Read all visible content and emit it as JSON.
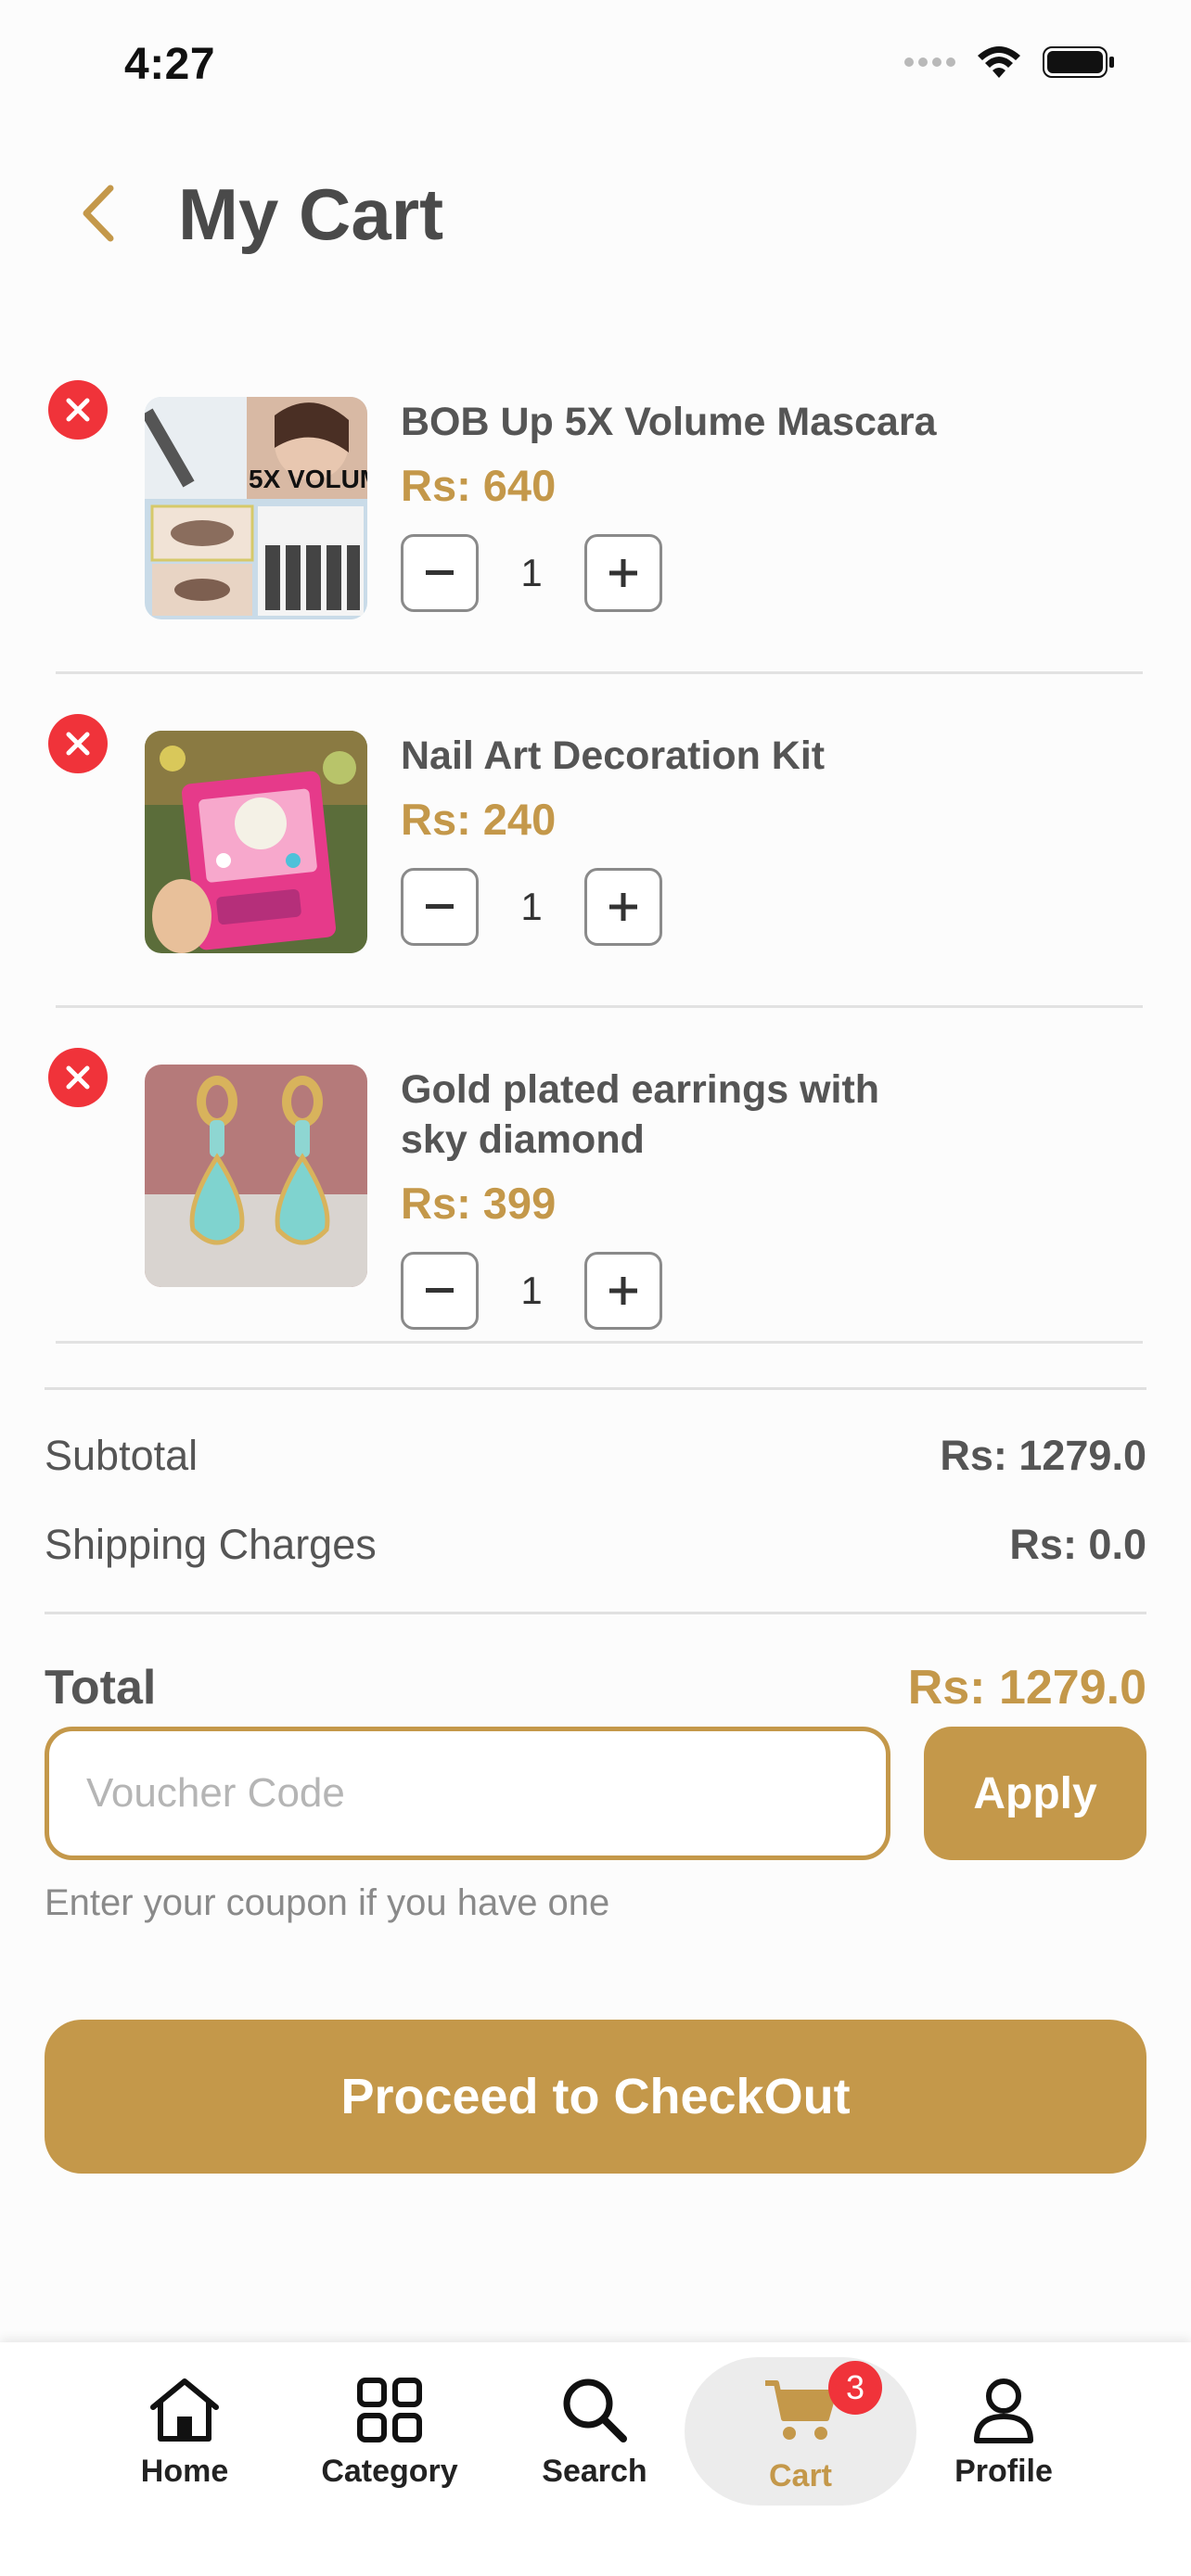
{
  "status_bar": {
    "time": "4:27"
  },
  "header": {
    "title": "My Cart"
  },
  "items": [
    {
      "name": "BOB Up 5X Volume Mascara",
      "price": "Rs: 640",
      "qty": "1",
      "image": "mascara-product-photo"
    },
    {
      "name": "Nail Art Decoration Kit",
      "price": "Rs: 240",
      "qty": "1",
      "image": "nail-kit-product-photo"
    },
    {
      "name": "Gold plated earrings with sky diamond",
      "price": "Rs: 399",
      "qty": "1",
      "image": "earrings-product-photo"
    }
  ],
  "summary": {
    "subtotal_label": "Subtotal",
    "subtotal_value": "Rs: 1279.0",
    "shipping_label": "Shipping Charges",
    "shipping_value": "Rs: 0.0",
    "total_label": "Total",
    "total_value": "Rs: 1279.0"
  },
  "voucher": {
    "placeholder": "Voucher Code",
    "value": "",
    "apply_label": "Apply",
    "hint": "Enter your coupon if you have one"
  },
  "checkout": {
    "label": "Proceed to CheckOut"
  },
  "nav": {
    "items": [
      {
        "label": "Home",
        "icon": "home-icon"
      },
      {
        "label": "Category",
        "icon": "grid-icon"
      },
      {
        "label": "Search",
        "icon": "search-icon"
      },
      {
        "label": "Cart",
        "icon": "cart-icon",
        "badge": "3",
        "active": true
      },
      {
        "label": "Profile",
        "icon": "person-icon"
      }
    ]
  },
  "colors": {
    "accent": "#c4984a",
    "danger": "#f0333a",
    "text": "#4a4a4a"
  }
}
